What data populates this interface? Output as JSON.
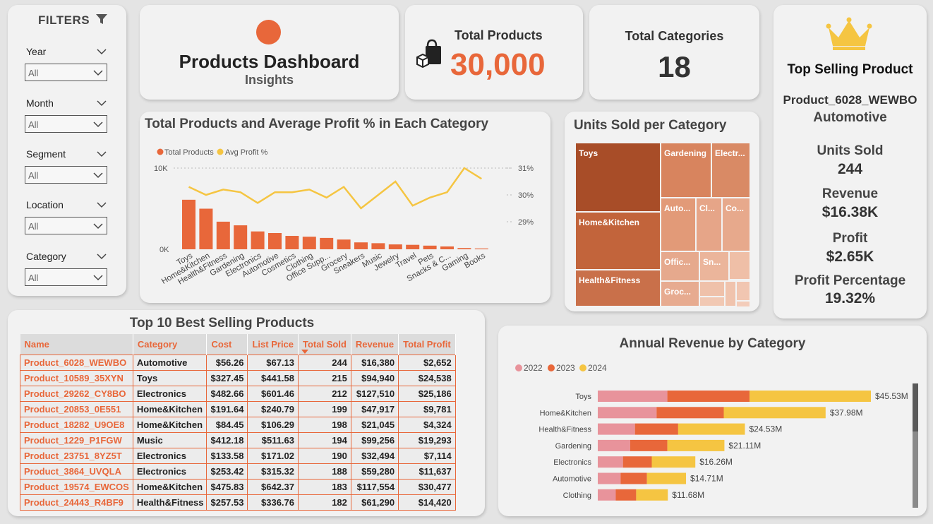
{
  "filters": {
    "header": "FILTERS",
    "items": [
      {
        "label": "Year",
        "value": "All"
      },
      {
        "label": "Month",
        "value": "All"
      },
      {
        "label": "Segment",
        "value": "All"
      },
      {
        "label": "Location",
        "value": "All"
      },
      {
        "label": "Category",
        "value": "All"
      }
    ]
  },
  "title_card": {
    "title": "Products Dashboard",
    "subtitle": "Insights"
  },
  "kpi_products": {
    "label": "Total Products",
    "value": "30,000"
  },
  "kpi_categories": {
    "label": "Total Categories",
    "value": "18"
  },
  "top_product": {
    "title": "Top Selling Product",
    "name": "Product_6028_WEWBO",
    "category": "Automotive",
    "units_label": "Units Sold",
    "units_value": "244",
    "revenue_label": "Revenue",
    "revenue_value": "$16.38K",
    "profit_label": "Profit",
    "profit_value": "$2.65K",
    "pct_label": "Profit Percentage",
    "pct_value": "19.32%"
  },
  "colors": {
    "accent": "#e8673a",
    "line": "#f5c542",
    "green": "#1f5d1f",
    "pink": "#e8939b"
  },
  "chart_data": [
    {
      "type": "bar",
      "title": "Total Products and Average Profit % in Each Category",
      "legend": [
        "Total Products",
        "Avg Profit %"
      ],
      "categories": [
        "Toys",
        "Home&Kitchen",
        "Health&Fitness",
        "Gardening",
        "Electronics",
        "Automotive",
        "Cosmetics",
        "Clothing",
        "Office Supp...",
        "Grocery",
        "Sneakers",
        "Music",
        "Jewelry",
        "Travel",
        "Pets",
        "Snacks & C...",
        "Gaming",
        "Books"
      ],
      "series": [
        {
          "name": "Total Products",
          "values": [
            6100,
            5000,
            3400,
            2950,
            2200,
            2000,
            1650,
            1550,
            1400,
            1200,
            850,
            750,
            600,
            550,
            450,
            350,
            150,
            100
          ]
        },
        {
          "name": "Avg Profit %",
          "values": [
            30.3,
            30.0,
            30.2,
            30.1,
            29.7,
            30.1,
            30.1,
            30.2,
            29.9,
            30.3,
            29.5,
            30.0,
            30.5,
            29.6,
            29.9,
            30.1,
            31.0,
            30.6
          ]
        }
      ],
      "y_left_ticks": [
        "0K",
        "10K"
      ],
      "y_right_ticks": [
        "29%",
        "30%",
        "31%"
      ],
      "ylim_left": [
        0,
        10000
      ],
      "ylim_right": [
        28.0,
        31.0
      ]
    },
    {
      "type": "treemap",
      "title": "Units Sold per Category",
      "labels": [
        "Toys",
        "Home&Kitchen",
        "Health&Fitness",
        "Gardening",
        "Electr...",
        "Auto...",
        "Cl...",
        "Co...",
        "Offic...",
        "Sn...",
        "Groc..."
      ]
    },
    {
      "type": "bar",
      "orientation": "horizontal-stacked",
      "title": "Annual Revenue by Category",
      "legend": [
        "2022",
        "2023",
        "2024"
      ],
      "categories": [
        "Toys",
        "Home&Kitchen",
        "Health&Fitness",
        "Gardening",
        "Electronics",
        "Automotive",
        "Clothing"
      ],
      "series": [
        {
          "name": "2022",
          "values": [
            11.6,
            9.8,
            6.2,
            5.4,
            4.2,
            3.8,
            3.0
          ]
        },
        {
          "name": "2023",
          "values": [
            13.7,
            11.2,
            7.2,
            6.2,
            4.8,
            4.4,
            3.4
          ]
        },
        {
          "name": "2024",
          "values": [
            20.23,
            16.98,
            11.13,
            9.51,
            7.26,
            6.51,
            5.28
          ]
        }
      ],
      "totals": [
        "$45.53M",
        "$37.98M",
        "$24.53M",
        "$21.11M",
        "$16.26M",
        "$14.71M",
        "$11.68M"
      ]
    }
  ],
  "table": {
    "title": "Top 10 Best Selling Products",
    "columns": [
      "Name",
      "Category",
      "Cost",
      "List Price",
      "Total Sold",
      "Revenue",
      "Total Profit"
    ],
    "rows": [
      [
        "Product_6028_WEWBO",
        "Automotive",
        "$56.26",
        "$67.13",
        "244",
        "$16,380",
        "$2,652"
      ],
      [
        "Product_10589_35XYN",
        "Toys",
        "$327.45",
        "$441.58",
        "215",
        "$94,940",
        "$24,538"
      ],
      [
        "Product_29262_CY8BO",
        "Electronics",
        "$482.66",
        "$601.46",
        "212",
        "$127,510",
        "$25,186"
      ],
      [
        "Product_20853_0E551",
        "Home&Kitchen",
        "$191.64",
        "$240.79",
        "199",
        "$47,917",
        "$9,781"
      ],
      [
        "Product_18282_U9OE8",
        "Home&Kitchen",
        "$84.45",
        "$106.29",
        "198",
        "$21,045",
        "$4,324"
      ],
      [
        "Product_1229_P1FGW",
        "Music",
        "$412.18",
        "$511.63",
        "194",
        "$99,256",
        "$19,293"
      ],
      [
        "Product_23751_8YZ5T",
        "Electronics",
        "$133.58",
        "$171.02",
        "190",
        "$32,494",
        "$7,114"
      ],
      [
        "Product_3864_UVQLA",
        "Electronics",
        "$253.42",
        "$315.32",
        "188",
        "$59,280",
        "$11,637"
      ],
      [
        "Product_19574_EWCOS",
        "Home&Kitchen",
        "$475.83",
        "$642.37",
        "183",
        "$117,554",
        "$30,477"
      ],
      [
        "Product_24443_R4BF9",
        "Health&Fitness",
        "$257.53",
        "$336.76",
        "182",
        "$61,290",
        "$14,420"
      ]
    ]
  }
}
